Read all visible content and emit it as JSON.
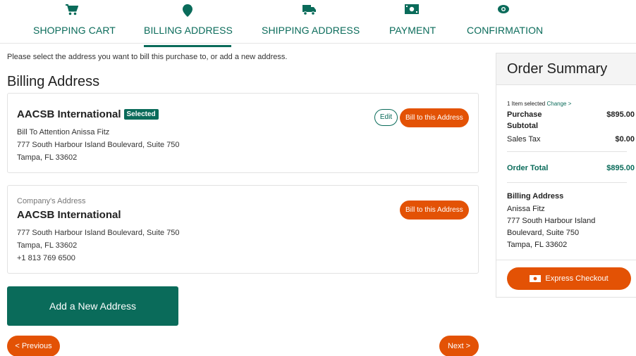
{
  "steps": [
    {
      "label": "SHOPPING CART",
      "icon": "cart-icon"
    },
    {
      "label": "BILLING ADDRESS",
      "icon": "map-pin-icon",
      "active": true
    },
    {
      "label": "SHIPPING ADDRESS",
      "icon": "truck-icon"
    },
    {
      "label": "PAYMENT",
      "icon": "money-icon"
    },
    {
      "label": "CONFIRMATION",
      "icon": "eye-icon"
    }
  ],
  "intro": "Please select the address you want to bill this purchase to, or add a new address.",
  "title": "Billing Address",
  "addresses": [
    {
      "name": "AACSB International",
      "badge": "Selected",
      "attention": "Bill To Attention Anissa Fitz",
      "street": "777 South Harbour Island Boulevard, Suite 750",
      "city": "Tampa, FL 33602",
      "edit_label": "Edit",
      "bill_label": "Bill to this Address"
    },
    {
      "sublabel": "Company's Address",
      "name": "AACSB International",
      "street": "777 South Harbour Island Boulevard, Suite 750",
      "city": "Tampa, FL 33602",
      "phone": "+1 813 769 6500",
      "bill_label": "Bill to this Address"
    }
  ],
  "add_address_label": "Add a New Address",
  "previous_label": "< Previous",
  "next_label": "Next >",
  "summary": {
    "title": "Order Summary",
    "items_selected": "1 Item selected",
    "change_label": "Change >",
    "purchase_label": "Purchase",
    "subtotal_label": "Subtotal",
    "purchase_value": "$895.00",
    "tax_label": "Sales Tax",
    "tax_value": "$0.00",
    "total_label": "Order Total",
    "total_value": "$895.00",
    "billing_heading": "Billing Address",
    "billing_name": "Anissa Fitz",
    "billing_line1": "777 South Harbour Island",
    "billing_line2": "Boulevard, Suite 750",
    "billing_line3": "Tampa, FL 33602",
    "express_label": "Express Checkout"
  },
  "colors": {
    "brand_green": "#0a6b5a",
    "accent_orange": "#e35205"
  }
}
